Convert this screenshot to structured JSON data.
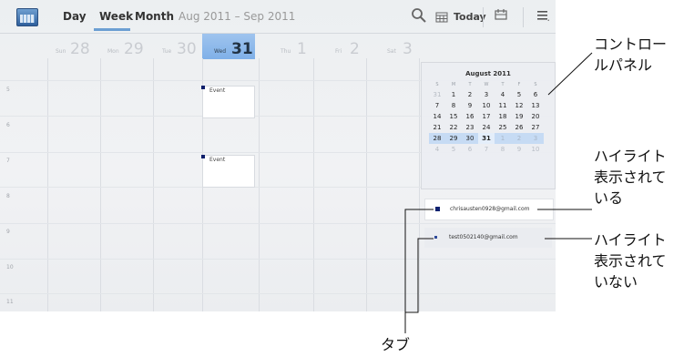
{
  "actionbar": {
    "tabs": [
      {
        "label": "Day"
      },
      {
        "label": "Week"
      },
      {
        "label": "Month"
      }
    ],
    "selected_tab": "Week",
    "date_range": "Aug 2011 – Sep 2011",
    "today_label": "Today",
    "icons": [
      "calendar-app-icon",
      "search-icon",
      "today-icon",
      "calendar-list-icon",
      "menu-icon"
    ]
  },
  "week": {
    "days": [
      {
        "name": "Sun",
        "num": "28"
      },
      {
        "name": "Mon",
        "num": "29"
      },
      {
        "name": "Tue",
        "num": "30"
      },
      {
        "name": "Wed",
        "num": "31"
      },
      {
        "name": "Thu",
        "num": "1"
      },
      {
        "name": "Fri",
        "num": "2"
      },
      {
        "name": "Sat",
        "num": "3"
      }
    ],
    "selected_day": "31",
    "hours": [
      "5",
      "6",
      "7",
      "8",
      "9",
      "10",
      "11"
    ],
    "events": [
      {
        "label": "Event"
      },
      {
        "label": "Event"
      }
    ]
  },
  "panel": {
    "month_title": "August 2011",
    "weekdays": [
      "S",
      "M",
      "T",
      "W",
      "T",
      "F",
      "S"
    ],
    "rows": [
      [
        "31",
        "1",
        "2",
        "3",
        "4",
        "5",
        "6"
      ],
      [
        "7",
        "8",
        "9",
        "10",
        "11",
        "12",
        "13"
      ],
      [
        "14",
        "15",
        "16",
        "17",
        "18",
        "19",
        "20"
      ],
      [
        "21",
        "22",
        "23",
        "24",
        "25",
        "26",
        "27"
      ],
      [
        "28",
        "29",
        "30",
        "31",
        "1",
        "2",
        "3"
      ],
      [
        "4",
        "5",
        "6",
        "7",
        "8",
        "9",
        "10"
      ]
    ],
    "accounts": [
      {
        "email": "chrisausten0928@gmail.com",
        "highlighted": true,
        "color": "#0f2270"
      },
      {
        "email": "test0502140@gmail.com",
        "highlighted": false,
        "color": "#2e4a9a"
      }
    ]
  },
  "annotations": {
    "control_panel": [
      "コントロー",
      "ルパネル"
    ],
    "highlighted": [
      "ハイライト",
      "表示されて",
      "いる"
    ],
    "not_highlighted": [
      "ハイライト",
      "表示されて",
      "いない"
    ],
    "tab": "タブ"
  }
}
